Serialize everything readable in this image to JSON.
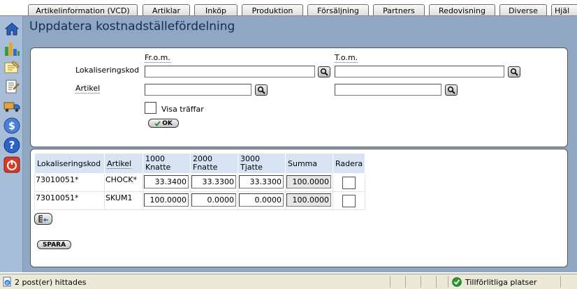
{
  "tabs": [
    {
      "label": "Artikelinformation (VCD)"
    },
    {
      "label": "Artiklar"
    },
    {
      "label": "Inköp"
    },
    {
      "label": "Produktion"
    },
    {
      "label": "Försäljning"
    },
    {
      "label": "Partners"
    },
    {
      "label": "Redovisning"
    },
    {
      "label": "Diverse"
    },
    {
      "label": "Hjäl"
    }
  ],
  "sidebar": {
    "icons": [
      "home-icon",
      "chart-icon",
      "notepad-icon",
      "edit-form-icon",
      "truck-icon",
      "dollar-icon",
      "help-icon",
      "power-icon"
    ]
  },
  "page": {
    "title": "Uppdatera kostnadställefördelning"
  },
  "filter": {
    "from_label": "Fr.o.m.",
    "to_label": "T.o.m.",
    "location_label": "Lokaliseringskod",
    "article_label": "Artikel",
    "location_from": "",
    "location_to": "",
    "article_from": "",
    "article_to": "",
    "show_hits_label": "Visa träffar",
    "show_hits_checked": false,
    "ok_label": "OK"
  },
  "table": {
    "headers": {
      "location": "Lokaliseringskod",
      "article": "Artikel",
      "col1_line1": "1000",
      "col1_line2": "Knatte",
      "col2_line1": "2000",
      "col2_line2": "Fnatte",
      "col3_line1": "3000",
      "col3_line2": "Tjatte",
      "sum": "Summa",
      "delete": "Radera"
    },
    "rows": [
      {
        "location": "73010051*",
        "article": "CHOCK*",
        "v1": "33.3400",
        "v2": "33.3300",
        "v3": "33.3300",
        "sum": "100.0000",
        "delete": false
      },
      {
        "location": "73010051*",
        "article": "SKUM1",
        "v1": "100.0000",
        "v2": "0.0000",
        "v3": "0.0000",
        "sum": "100.0000",
        "delete": false
      }
    ]
  },
  "actions": {
    "save_label": "SPARA"
  },
  "status": {
    "text": "2 post(er) hittades",
    "zone": "Tillförlitliga platser"
  },
  "colors": {
    "background": "#8fa7c3",
    "sidebar": "#a7bdd8",
    "header_cell": "#d7e2f2",
    "title": "#1c2b55"
  }
}
